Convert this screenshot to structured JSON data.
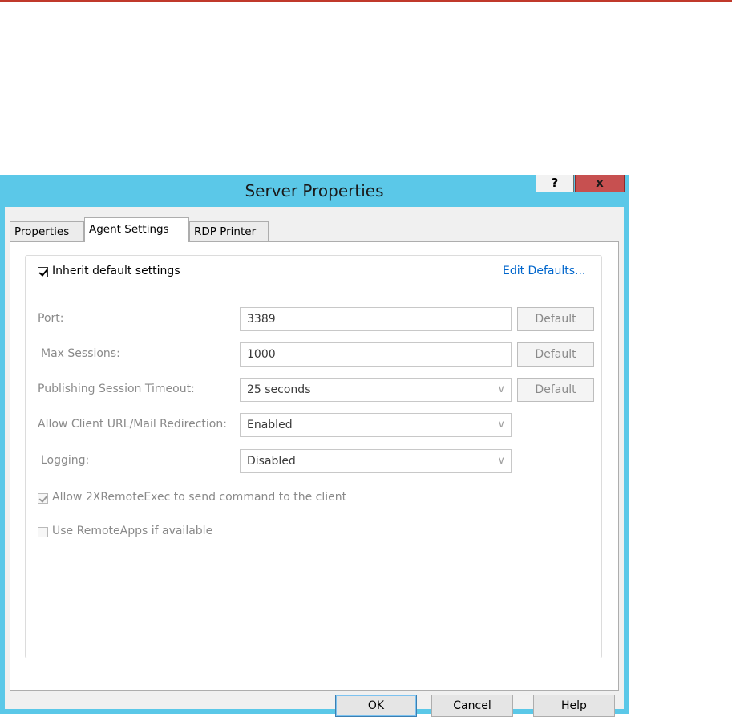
{
  "window": {
    "title": "Server Properties",
    "help_label": "?",
    "close_label": "x"
  },
  "tabs": [
    {
      "label": "Properties"
    },
    {
      "label": "Agent Settings"
    },
    {
      "label": "RDP Printer"
    }
  ],
  "agent_settings": {
    "inherit_label": "Inherit default settings",
    "inherit_checked": true,
    "edit_defaults_label": "Edit Defaults...",
    "port": {
      "label": "Port:",
      "value": "3389",
      "default_label": "Default"
    },
    "max_sessions": {
      "label": "Max Sessions:",
      "value": "1000",
      "default_label": "Default"
    },
    "publishing_timeout": {
      "label": "Publishing Session Timeout:",
      "value": "25 seconds",
      "default_label": "Default"
    },
    "url_redirection": {
      "label": "Allow Client URL/Mail Redirection:",
      "value": "Enabled"
    },
    "logging": {
      "label": "Logging:",
      "value": "Disabled"
    },
    "allow_remote_exec": {
      "label": "Allow 2XRemoteExec to send command to the client",
      "checked": true
    },
    "use_remote_apps": {
      "label": "Use RemoteApps if available",
      "checked": false
    }
  },
  "buttons": {
    "ok": "OK",
    "cancel": "Cancel",
    "help": "Help"
  },
  "colors": {
    "titlebar": "#5bc8e8",
    "close_button": "#c75050",
    "link": "#0066cc",
    "top_rule": "#c0392b"
  },
  "icons": {
    "dropdown": "chevron-down-icon",
    "check": "checkmark-icon"
  }
}
